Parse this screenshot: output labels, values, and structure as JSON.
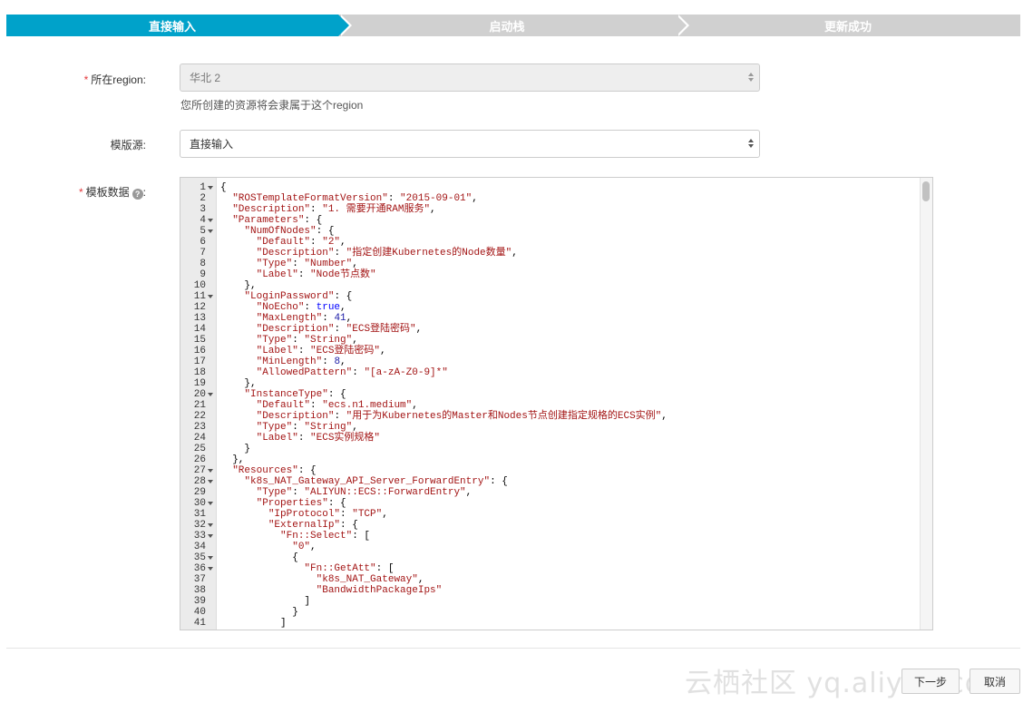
{
  "stepper": {
    "steps": [
      {
        "label": "直接输入",
        "active": true
      },
      {
        "label": "启动栈",
        "active": false
      },
      {
        "label": "更新成功",
        "active": false
      }
    ],
    "active_color": "#00a2ca",
    "inactive_color": "#d0d0d0"
  },
  "form": {
    "region": {
      "required_mark": "*",
      "label": "所在region:",
      "value": "华北 2",
      "hint": "您所创建的资源将会隶属于这个region"
    },
    "template_source": {
      "label": "模版源:",
      "value": "直接输入"
    },
    "template_data": {
      "required_mark": "*",
      "label": "模板数据",
      "label_suffix": ":",
      "help_icon": "?"
    }
  },
  "editor": {
    "lines": [
      {
        "n": "1",
        "fold": true,
        "text": "{"
      },
      {
        "n": "2",
        "fold": false,
        "text": "  \"ROSTemplateFormatVersion\": \"2015-09-01\","
      },
      {
        "n": "3",
        "fold": false,
        "text": "  \"Description\": \"1. 需要开通RAM服务\","
      },
      {
        "n": "4",
        "fold": true,
        "text": "  \"Parameters\": {"
      },
      {
        "n": "5",
        "fold": true,
        "text": "    \"NumOfNodes\": {"
      },
      {
        "n": "6",
        "fold": false,
        "text": "      \"Default\": \"2\","
      },
      {
        "n": "7",
        "fold": false,
        "text": "      \"Description\": \"指定创建Kubernetes的Node数量\","
      },
      {
        "n": "8",
        "fold": false,
        "text": "      \"Type\": \"Number\","
      },
      {
        "n": "9",
        "fold": false,
        "text": "      \"Label\": \"Node节点数\""
      },
      {
        "n": "10",
        "fold": false,
        "text": "    },"
      },
      {
        "n": "11",
        "fold": true,
        "text": "    \"LoginPassword\": {"
      },
      {
        "n": "12",
        "fold": false,
        "text": "      \"NoEcho\": true,"
      },
      {
        "n": "13",
        "fold": false,
        "text": "      \"MaxLength\": 41,"
      },
      {
        "n": "14",
        "fold": false,
        "text": "      \"Description\": \"ECS登陆密码\","
      },
      {
        "n": "15",
        "fold": false,
        "text": "      \"Type\": \"String\","
      },
      {
        "n": "16",
        "fold": false,
        "text": "      \"Label\": \"ECS登陆密码\","
      },
      {
        "n": "17",
        "fold": false,
        "text": "      \"MinLength\": 8,"
      },
      {
        "n": "18",
        "fold": false,
        "text": "      \"AllowedPattern\": \"[a-zA-Z0-9]*\""
      },
      {
        "n": "19",
        "fold": false,
        "text": "    },"
      },
      {
        "n": "20",
        "fold": true,
        "text": "    \"InstanceType\": {"
      },
      {
        "n": "21",
        "fold": false,
        "text": "      \"Default\": \"ecs.n1.medium\","
      },
      {
        "n": "22",
        "fold": false,
        "text": "      \"Description\": \"用于为Kubernetes的Master和Nodes节点创建指定规格的ECS实例\","
      },
      {
        "n": "23",
        "fold": false,
        "text": "      \"Type\": \"String\","
      },
      {
        "n": "24",
        "fold": false,
        "text": "      \"Label\": \"ECS实例规格\""
      },
      {
        "n": "25",
        "fold": false,
        "text": "    }"
      },
      {
        "n": "26",
        "fold": false,
        "text": "  },"
      },
      {
        "n": "27",
        "fold": true,
        "text": "  \"Resources\": {"
      },
      {
        "n": "28",
        "fold": true,
        "text": "    \"k8s_NAT_Gateway_API_Server_ForwardEntry\": {"
      },
      {
        "n": "29",
        "fold": false,
        "text": "      \"Type\": \"ALIYUN::ECS::ForwardEntry\","
      },
      {
        "n": "30",
        "fold": true,
        "text": "      \"Properties\": {"
      },
      {
        "n": "31",
        "fold": false,
        "text": "        \"IpProtocol\": \"TCP\","
      },
      {
        "n": "32",
        "fold": true,
        "text": "        \"ExternalIp\": {"
      },
      {
        "n": "33",
        "fold": true,
        "text": "          \"Fn::Select\": ["
      },
      {
        "n": "34",
        "fold": false,
        "text": "            \"0\","
      },
      {
        "n": "35",
        "fold": true,
        "text": "            {"
      },
      {
        "n": "36",
        "fold": true,
        "text": "              \"Fn::GetAtt\": ["
      },
      {
        "n": "37",
        "fold": false,
        "text": "                \"k8s_NAT_Gateway\","
      },
      {
        "n": "38",
        "fold": false,
        "text": "                \"BandwidthPackageIps\""
      },
      {
        "n": "39",
        "fold": false,
        "text": "              ]"
      },
      {
        "n": "40",
        "fold": false,
        "text": "            }"
      },
      {
        "n": "41",
        "fold": false,
        "text": "          ]"
      }
    ]
  },
  "footer": {
    "next_label": "下一步",
    "cancel_label": "取消"
  },
  "watermark": "云栖社区 yq.aliyun.com"
}
